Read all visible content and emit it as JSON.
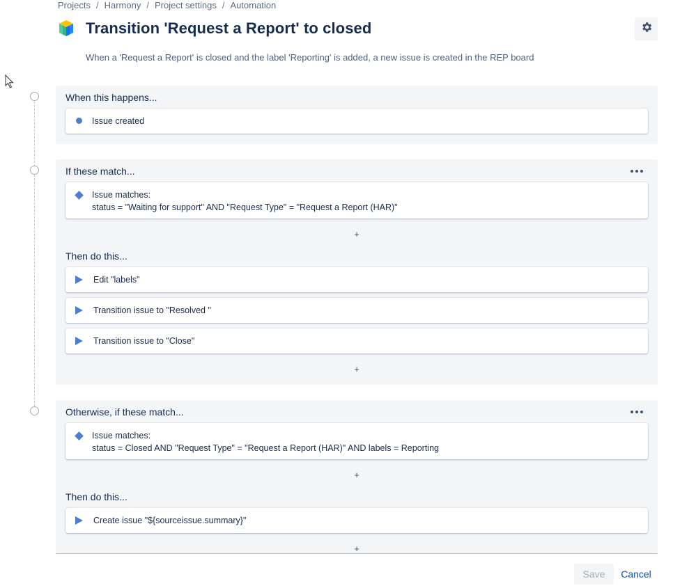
{
  "breadcrumb": [
    "Projects",
    "Harmony",
    "Project settings",
    "Automation"
  ],
  "breadcrumb_separator": "/",
  "header": {
    "title": "Transition 'Request a Report' to closed",
    "description": "When a 'Request a Report' is closed and the label 'Reporting' is added, a new issue is created in the REP board",
    "settings_icon": "gear-icon",
    "project_icon": "cube-icon"
  },
  "trigger": {
    "title": "When this happens...",
    "card": {
      "icon": "dot-icon",
      "text": "Issue created"
    }
  },
  "if_block": {
    "title": "If these match...",
    "condition": {
      "icon": "diamond-icon",
      "label": "Issue matches:",
      "query": "status = \"Waiting for support\" AND \"Request Type\" = \"Request a Report (HAR)\""
    },
    "add_symbol": "+",
    "then_title": "Then do this...",
    "actions": [
      {
        "icon": "play-icon",
        "text": "Edit \"labels\""
      },
      {
        "icon": "play-icon",
        "text": "Transition issue to \"Resolved \""
      },
      {
        "icon": "play-icon",
        "text": "Transition issue to \"Close\""
      }
    ]
  },
  "else_if_block": {
    "title": "Otherwise, if these match...",
    "condition": {
      "icon": "diamond-icon",
      "label": "Issue matches:",
      "query": "status = Closed AND \"Request Type\" = \"Request a Report (HAR)\" AND labels = Reporting"
    },
    "add_symbol": "+",
    "then_title": "Then do this...",
    "actions": [
      {
        "icon": "play-icon",
        "text": "Create issue \"${sourceissue.summary}\""
      }
    ]
  },
  "footer": {
    "save_label": "Save",
    "cancel_label": "Cancel"
  },
  "colors": {
    "accent": "#4c7fd4",
    "link": "#0052cc",
    "section_bg": "#f4f5f7",
    "text": "#172b4d"
  }
}
